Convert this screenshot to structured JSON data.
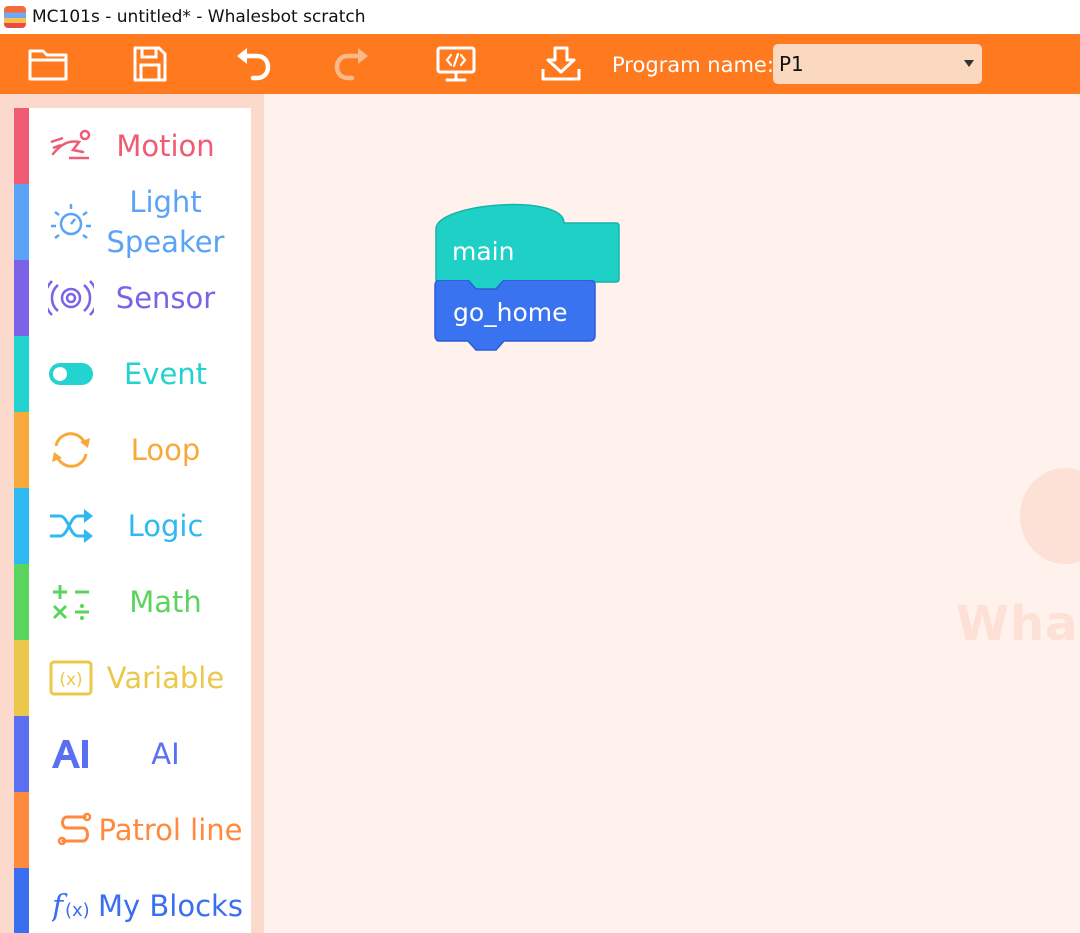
{
  "window": {
    "title": "MC101s - untitled*  - Whalesbot scratch"
  },
  "toolbar": {
    "buttons": [
      {
        "name": "open-folder-icon"
      },
      {
        "name": "save-icon"
      },
      {
        "name": "undo-icon"
      },
      {
        "name": "redo-icon"
      },
      {
        "name": "code-view-icon"
      },
      {
        "name": "download-icon"
      }
    ],
    "program_name_label": "Program name:",
    "program_name_value": "P1"
  },
  "sidebar": {
    "categories": [
      {
        "label": "Motion",
        "color": "#f05a72",
        "icon": "motion-icon"
      },
      {
        "label": "Light Speaker",
        "color": "#5aa3f5",
        "icon": "light-speaker-icon"
      },
      {
        "label": "Sensor",
        "color": "#7b63e8",
        "icon": "sensor-icon"
      },
      {
        "label": "Event",
        "color": "#22d3cf",
        "icon": "event-toggle-icon"
      },
      {
        "label": "Loop",
        "color": "#f9a83a",
        "icon": "loop-icon"
      },
      {
        "label": "Logic",
        "color": "#2eb9f1",
        "icon": "logic-icon"
      },
      {
        "label": "Math",
        "color": "#59d45c",
        "icon": "math-icon"
      },
      {
        "label": "Variable",
        "color": "#ecc84a",
        "icon": "variable-icon"
      },
      {
        "label": "AI",
        "color": "#5b70f0",
        "icon": "ai-icon"
      },
      {
        "label": "Patrol line",
        "color": "#ff8a3d",
        "icon": "patrol-line-icon"
      },
      {
        "label": "My Blocks",
        "color": "#3a6ff0",
        "icon": "my-blocks-icon"
      }
    ]
  },
  "workspace": {
    "blocks": [
      {
        "label": "main",
        "color": "#1fd0c6"
      },
      {
        "label": "go_home",
        "color": "#3a73f0"
      }
    ],
    "watermark": "Whale"
  }
}
